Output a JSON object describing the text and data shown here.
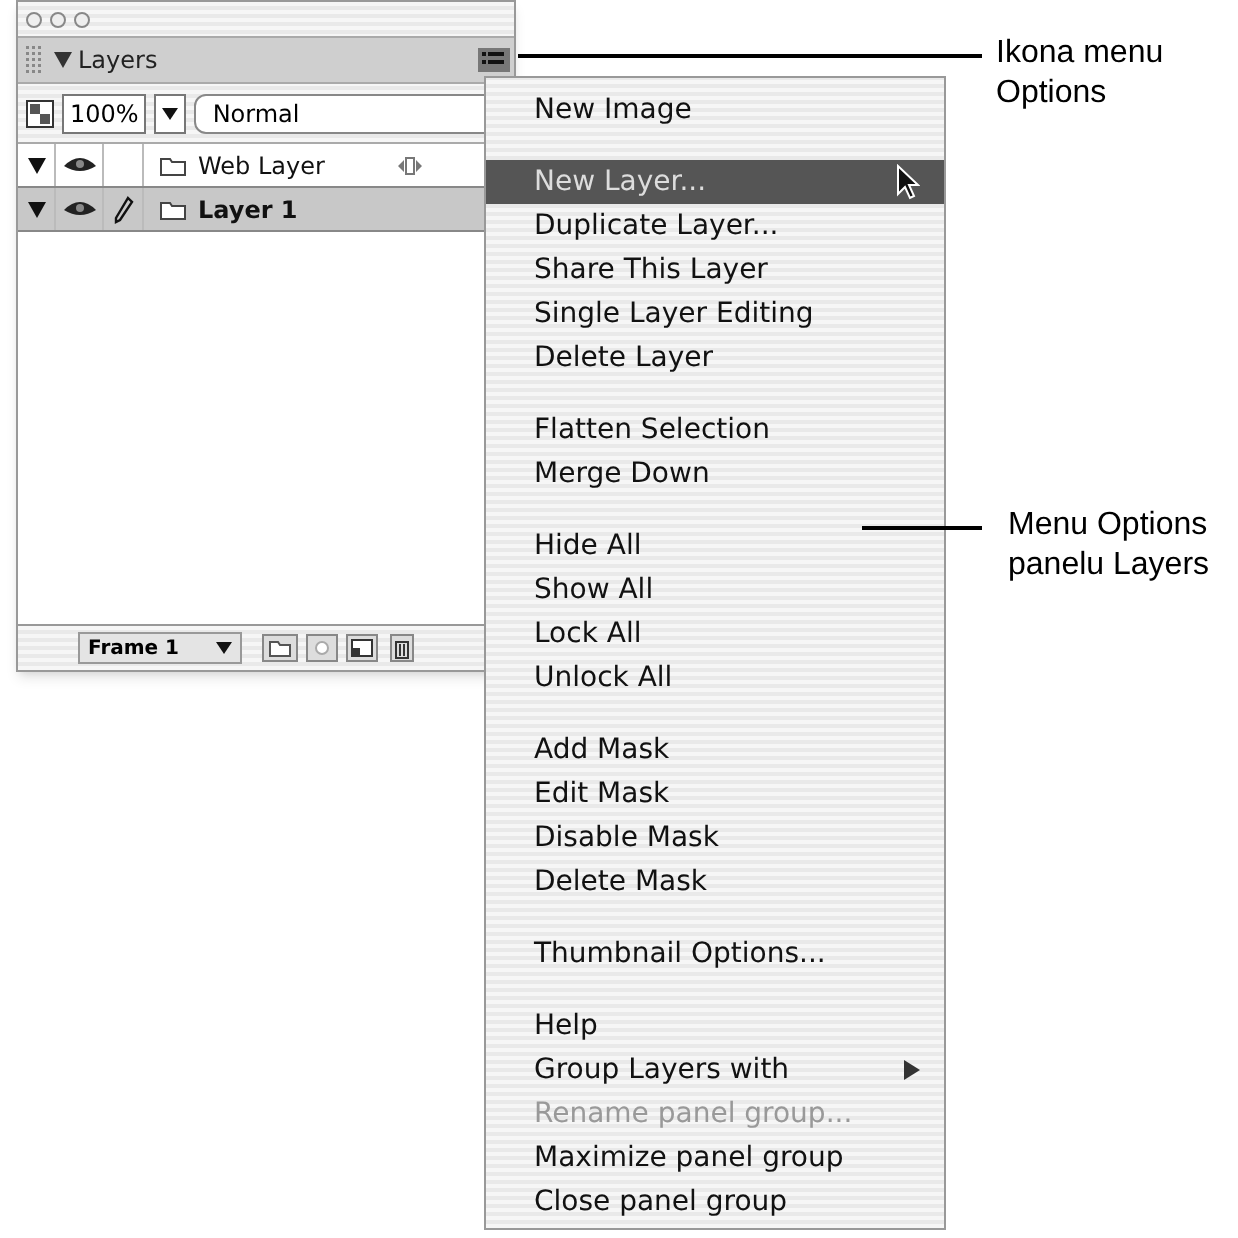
{
  "panel": {
    "title": "Layers",
    "zoom": "100%",
    "blend_mode": "Normal",
    "layers": [
      {
        "name": "Web Layer",
        "kind": "web",
        "expanded": true,
        "visible": true,
        "editable": false,
        "selected": false
      },
      {
        "name": "Layer 1",
        "kind": "layer",
        "expanded": true,
        "visible": true,
        "editable": true,
        "selected": true
      }
    ],
    "frame": "Frame 1"
  },
  "menu": {
    "groups": [
      [
        {
          "label": "New Image",
          "kind": "command",
          "selected": false,
          "disabled": false
        }
      ],
      [
        {
          "label": "New Layer...",
          "kind": "command",
          "selected": true,
          "disabled": false
        },
        {
          "label": "Duplicate Layer...",
          "kind": "command",
          "selected": false,
          "disabled": false
        },
        {
          "label": "Share This Layer",
          "kind": "command",
          "selected": false,
          "disabled": false
        },
        {
          "label": "Single Layer Editing",
          "kind": "command",
          "selected": false,
          "disabled": false
        },
        {
          "label": "Delete Layer",
          "kind": "command",
          "selected": false,
          "disabled": false
        }
      ],
      [
        {
          "label": "Flatten Selection",
          "kind": "command",
          "selected": false,
          "disabled": false
        },
        {
          "label": "Merge Down",
          "kind": "command",
          "selected": false,
          "disabled": false
        }
      ],
      [
        {
          "label": "Hide All",
          "kind": "command",
          "selected": false,
          "disabled": false
        },
        {
          "label": "Show All",
          "kind": "command",
          "selected": false,
          "disabled": false
        },
        {
          "label": "Lock All",
          "kind": "command",
          "selected": false,
          "disabled": false
        },
        {
          "label": "Unlock All",
          "kind": "command",
          "selected": false,
          "disabled": false
        }
      ],
      [
        {
          "label": "Add Mask",
          "kind": "command",
          "selected": false,
          "disabled": false
        },
        {
          "label": "Edit Mask",
          "kind": "command",
          "selected": false,
          "disabled": false
        },
        {
          "label": "Disable Mask",
          "kind": "command",
          "selected": false,
          "disabled": false
        },
        {
          "label": "Delete Mask",
          "kind": "command",
          "selected": false,
          "disabled": false
        }
      ],
      [
        {
          "label": "Thumbnail Options...",
          "kind": "command",
          "selected": false,
          "disabled": false
        }
      ],
      [
        {
          "label": "Help",
          "kind": "command",
          "selected": false,
          "disabled": false
        },
        {
          "label": "Group Layers with",
          "kind": "submenu",
          "selected": false,
          "disabled": false
        },
        {
          "label": "Rename panel group...",
          "kind": "command",
          "selected": false,
          "disabled": true
        },
        {
          "label": "Maximize panel group",
          "kind": "command",
          "selected": false,
          "disabled": false
        },
        {
          "label": "Close panel group",
          "kind": "command",
          "selected": false,
          "disabled": false
        }
      ]
    ]
  },
  "callouts": [
    {
      "lines": [
        "Ikona menu",
        "Options"
      ]
    },
    {
      "lines": [
        "Menu Options",
        "panelu Layers"
      ]
    }
  ]
}
